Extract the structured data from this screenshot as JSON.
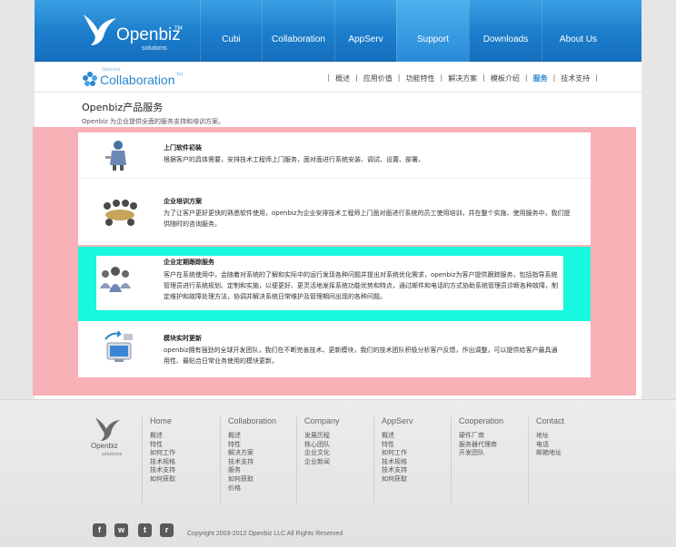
{
  "header": {
    "brand": "Openbiz",
    "brand_sub": "solutions",
    "brand_tm": "TM",
    "nav": [
      {
        "label": "Cubi"
      },
      {
        "label": "Collaboration"
      },
      {
        "label": "AppServ"
      },
      {
        "label": "Support",
        "active": true
      },
      {
        "label": "Downloads"
      },
      {
        "label": "About Us"
      }
    ]
  },
  "subheader": {
    "product_sup": "Openbiz",
    "product": "Collaboration",
    "product_tm": "TM",
    "nav": [
      "概述",
      "应用价值",
      "功能特性",
      "解决方案",
      "模板介绍",
      "服务",
      "技术支持"
    ],
    "active_index": 5
  },
  "main": {
    "title": "Openbiz产品服务",
    "subtitle": "Openbiz 为企业提供全面的服务支持和培训方案。",
    "services": [
      {
        "title": "上门软件初装",
        "desc": "根据客户的具体需要，安排技术工程师上门服务，面对面进行系统安装、调试、设置、部署。",
        "icon": "installer-person-icon"
      },
      {
        "title": "企业培训方案",
        "desc": "为了让客户更好更快的熟悉软件使用，openbiz为企业安排技术工程师上门面对面进行系统的员工使用培训，并在整个实施、使用服务中，我们提供随时的咨询服务。",
        "icon": "meeting-table-icon"
      },
      {
        "title": "企业定期跟踪服务",
        "desc": "客户在系统使用中，会随着对系统的了解和实际中的运行发现各种问题并提出对系统优化需求，openbiz为客户提供跟踪服务，包括指导系统管理员进行系统规划、定制和实施，以便更好、更灵活地发挥系统功能优势和特点，通过邮件和电话的方式协助系统管理员诊断各种故障，制定维护和故障处理方法，协调并解决系统日常维护及管理期间出现的各种问题。",
        "icon": "team-group-icon",
        "highlighted": true
      },
      {
        "title": "模块实时更新",
        "desc": "openbiz拥有强劲的全球开发团队，我们在不断完善技术、更新模块，我们的技术团队积极分析客户反馈，作出调整，可以提供给客户最具通用性、最贴合日常业务使用的模块更新。",
        "icon": "computer-update-icon"
      }
    ]
  },
  "footer": {
    "brand": "Openbiz",
    "brand_sub": "solutions",
    "columns": [
      {
        "title": "Home",
        "links": [
          "概述",
          "特性",
          "如何工作",
          "技术规格",
          "技术支持",
          "如何获取"
        ]
      },
      {
        "title": "Collaboration",
        "links": [
          "概述",
          "特性",
          "解决方案",
          "技术支持",
          "服务",
          "如何获取",
          "价格"
        ]
      },
      {
        "title": "Company",
        "links": [
          "发展历程",
          "核心团队",
          "企业文化",
          "企业新闻"
        ]
      },
      {
        "title": "AppServ",
        "links": [
          "概述",
          "特性",
          "如何工作",
          "技术规格",
          "技术支持",
          "如何获取"
        ]
      },
      {
        "title": "Cooperation",
        "links": [
          "硬件厂商",
          "服务器代理商",
          "开发团队"
        ]
      },
      {
        "title": "Contact",
        "links": [
          "地址",
          "电话",
          "邮箱地址"
        ]
      }
    ],
    "social": [
      {
        "name": "facebook-icon",
        "glyph": "f"
      },
      {
        "name": "weibo-icon",
        "glyph": "w"
      },
      {
        "name": "twitter-icon",
        "glyph": "t"
      },
      {
        "name": "rss-icon",
        "glyph": "r"
      }
    ],
    "copyright": "Copyright 2003-2012 Openbiz LLC All Rights Reserved"
  },
  "colors": {
    "nav_blue": "#1b7dcb",
    "accent": "#2a87d0",
    "panel_pink": "#f7b1b7",
    "highlight_cyan": "#18f7df"
  }
}
